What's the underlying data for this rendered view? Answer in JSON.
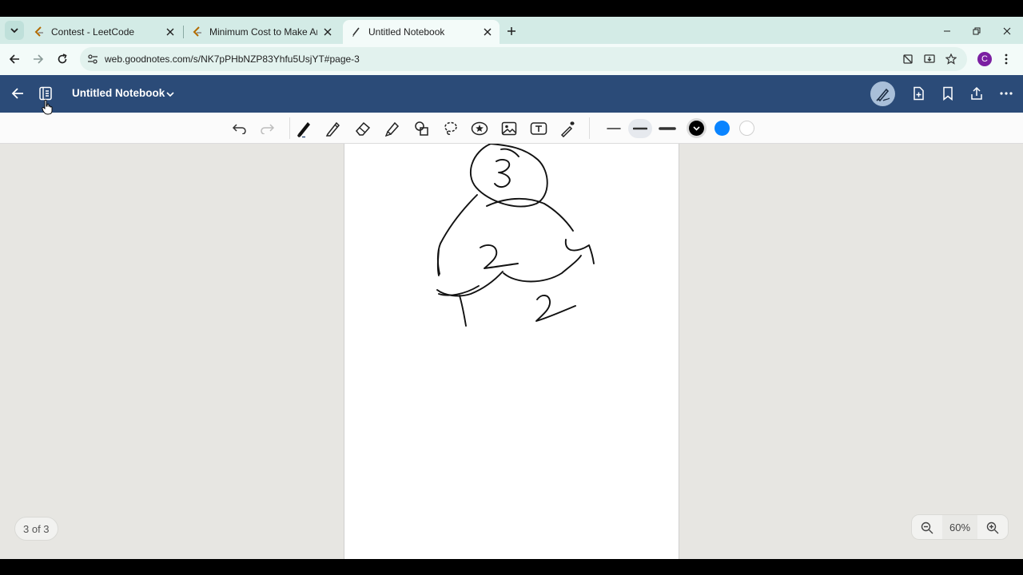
{
  "browser": {
    "tabs": [
      {
        "title": "Contest - LeetCode",
        "favicon": "leetcode-icon",
        "active": false
      },
      {
        "title": "Minimum Cost to Make Arrays",
        "favicon": "leetcode-icon",
        "active": false
      },
      {
        "title": "Untitled Notebook",
        "favicon": "goodnotes-icon",
        "active": true
      }
    ],
    "url": "web.goodnotes.com/s/NK7pPHbNZP83Yhfu5UsjYT#page-3",
    "profile_initial": "C",
    "profile_color": "#7b1fa2"
  },
  "app": {
    "title": "Untitled Notebook",
    "header_color": "#2b4b78",
    "toolbar": {
      "tools": [
        "undo-icon",
        "redo-icon",
        "pen-icon",
        "pencil-icon",
        "eraser-icon",
        "highlighter-icon",
        "shapes-icon",
        "lasso-icon",
        "sticker-icon",
        "image-icon",
        "text-icon",
        "laser-pointer-icon"
      ],
      "selected_tool": "pen-icon",
      "stroke_widths": [
        "thin",
        "medium",
        "thick"
      ],
      "selected_stroke": "medium",
      "colors": [
        "#000000",
        "#0a84ff",
        "#ffffff"
      ],
      "selected_color": "#000000"
    }
  },
  "canvas": {
    "background": "#e7e6e2",
    "page_indicator": "3 of 3",
    "zoom": "60%"
  }
}
